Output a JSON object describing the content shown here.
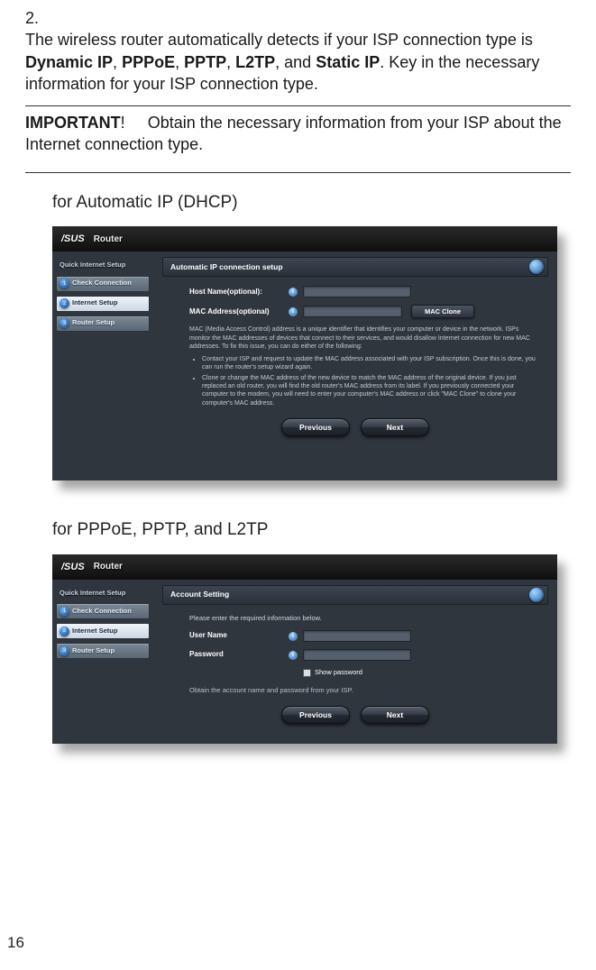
{
  "step": {
    "number": "2.",
    "text_pre": "The wireless router automatically detects if your ISP connection type is ",
    "b1": "Dynamic IP",
    "c1": ", ",
    "b2": "PPPoE",
    "c2": ", ",
    "b3": "PPTP",
    "c3": ", ",
    "b4": "L2TP",
    "c4": ", and ",
    "b5": "Static IP",
    "text_post": ". Key in the necessary information for your ISP connection type."
  },
  "important": {
    "label": "IMPORTANT",
    "excl": "!",
    "gap": "     ",
    "text": "Obtain the necessary information from your ISP about the Internet connection type."
  },
  "section1_title": "for Automatic IP (DHCP)",
  "section2_title": "for PPPoE, PPTP, and L2TP",
  "page_number": "16",
  "router": {
    "brand": "/SUS",
    "model": "Router",
    "qis": "Quick Internet Setup",
    "wiz": [
      "Check Connection",
      "Internet Setup",
      "Router Setup"
    ]
  },
  "screen1": {
    "title": "Automatic IP connection setup",
    "row1_label": "Host Name(optional):",
    "row2_label": "MAC Address(optional)",
    "mac_clone": "MAC Clone",
    "info_para": "MAC (Media Access Control) address is a unique identifier that identifies your computer or device in the network. ISPs monitor the MAC addresses of devices that connect to their services, and would disallow Internet connection for new MAC addresses. To fix this issue, you can do either of the following:",
    "info_li1": "Contact your ISP and request to update the MAC address associated with your ISP subscription. Once this is done, you can run the router's setup wizard again.",
    "info_li2": "Clone or change the MAC address of the new device to match the MAC address of the original device. If you just replaced an old router, you will find the old router's MAC address from its label. If you previously connected your computer to the modem, you will need to enter your computer's MAC address or click \"MAC Clone\" to clone your computer's MAC address.",
    "prev": "Previous",
    "next": "Next"
  },
  "screen2": {
    "title": "Account Setting",
    "hint": "Please enter the required information below.",
    "row1_label": "User Name",
    "row2_label": "Password",
    "show_pw": "Show password",
    "obtain": "Obtain the account name and password from your ISP.",
    "prev": "Previous",
    "next": "Next"
  }
}
